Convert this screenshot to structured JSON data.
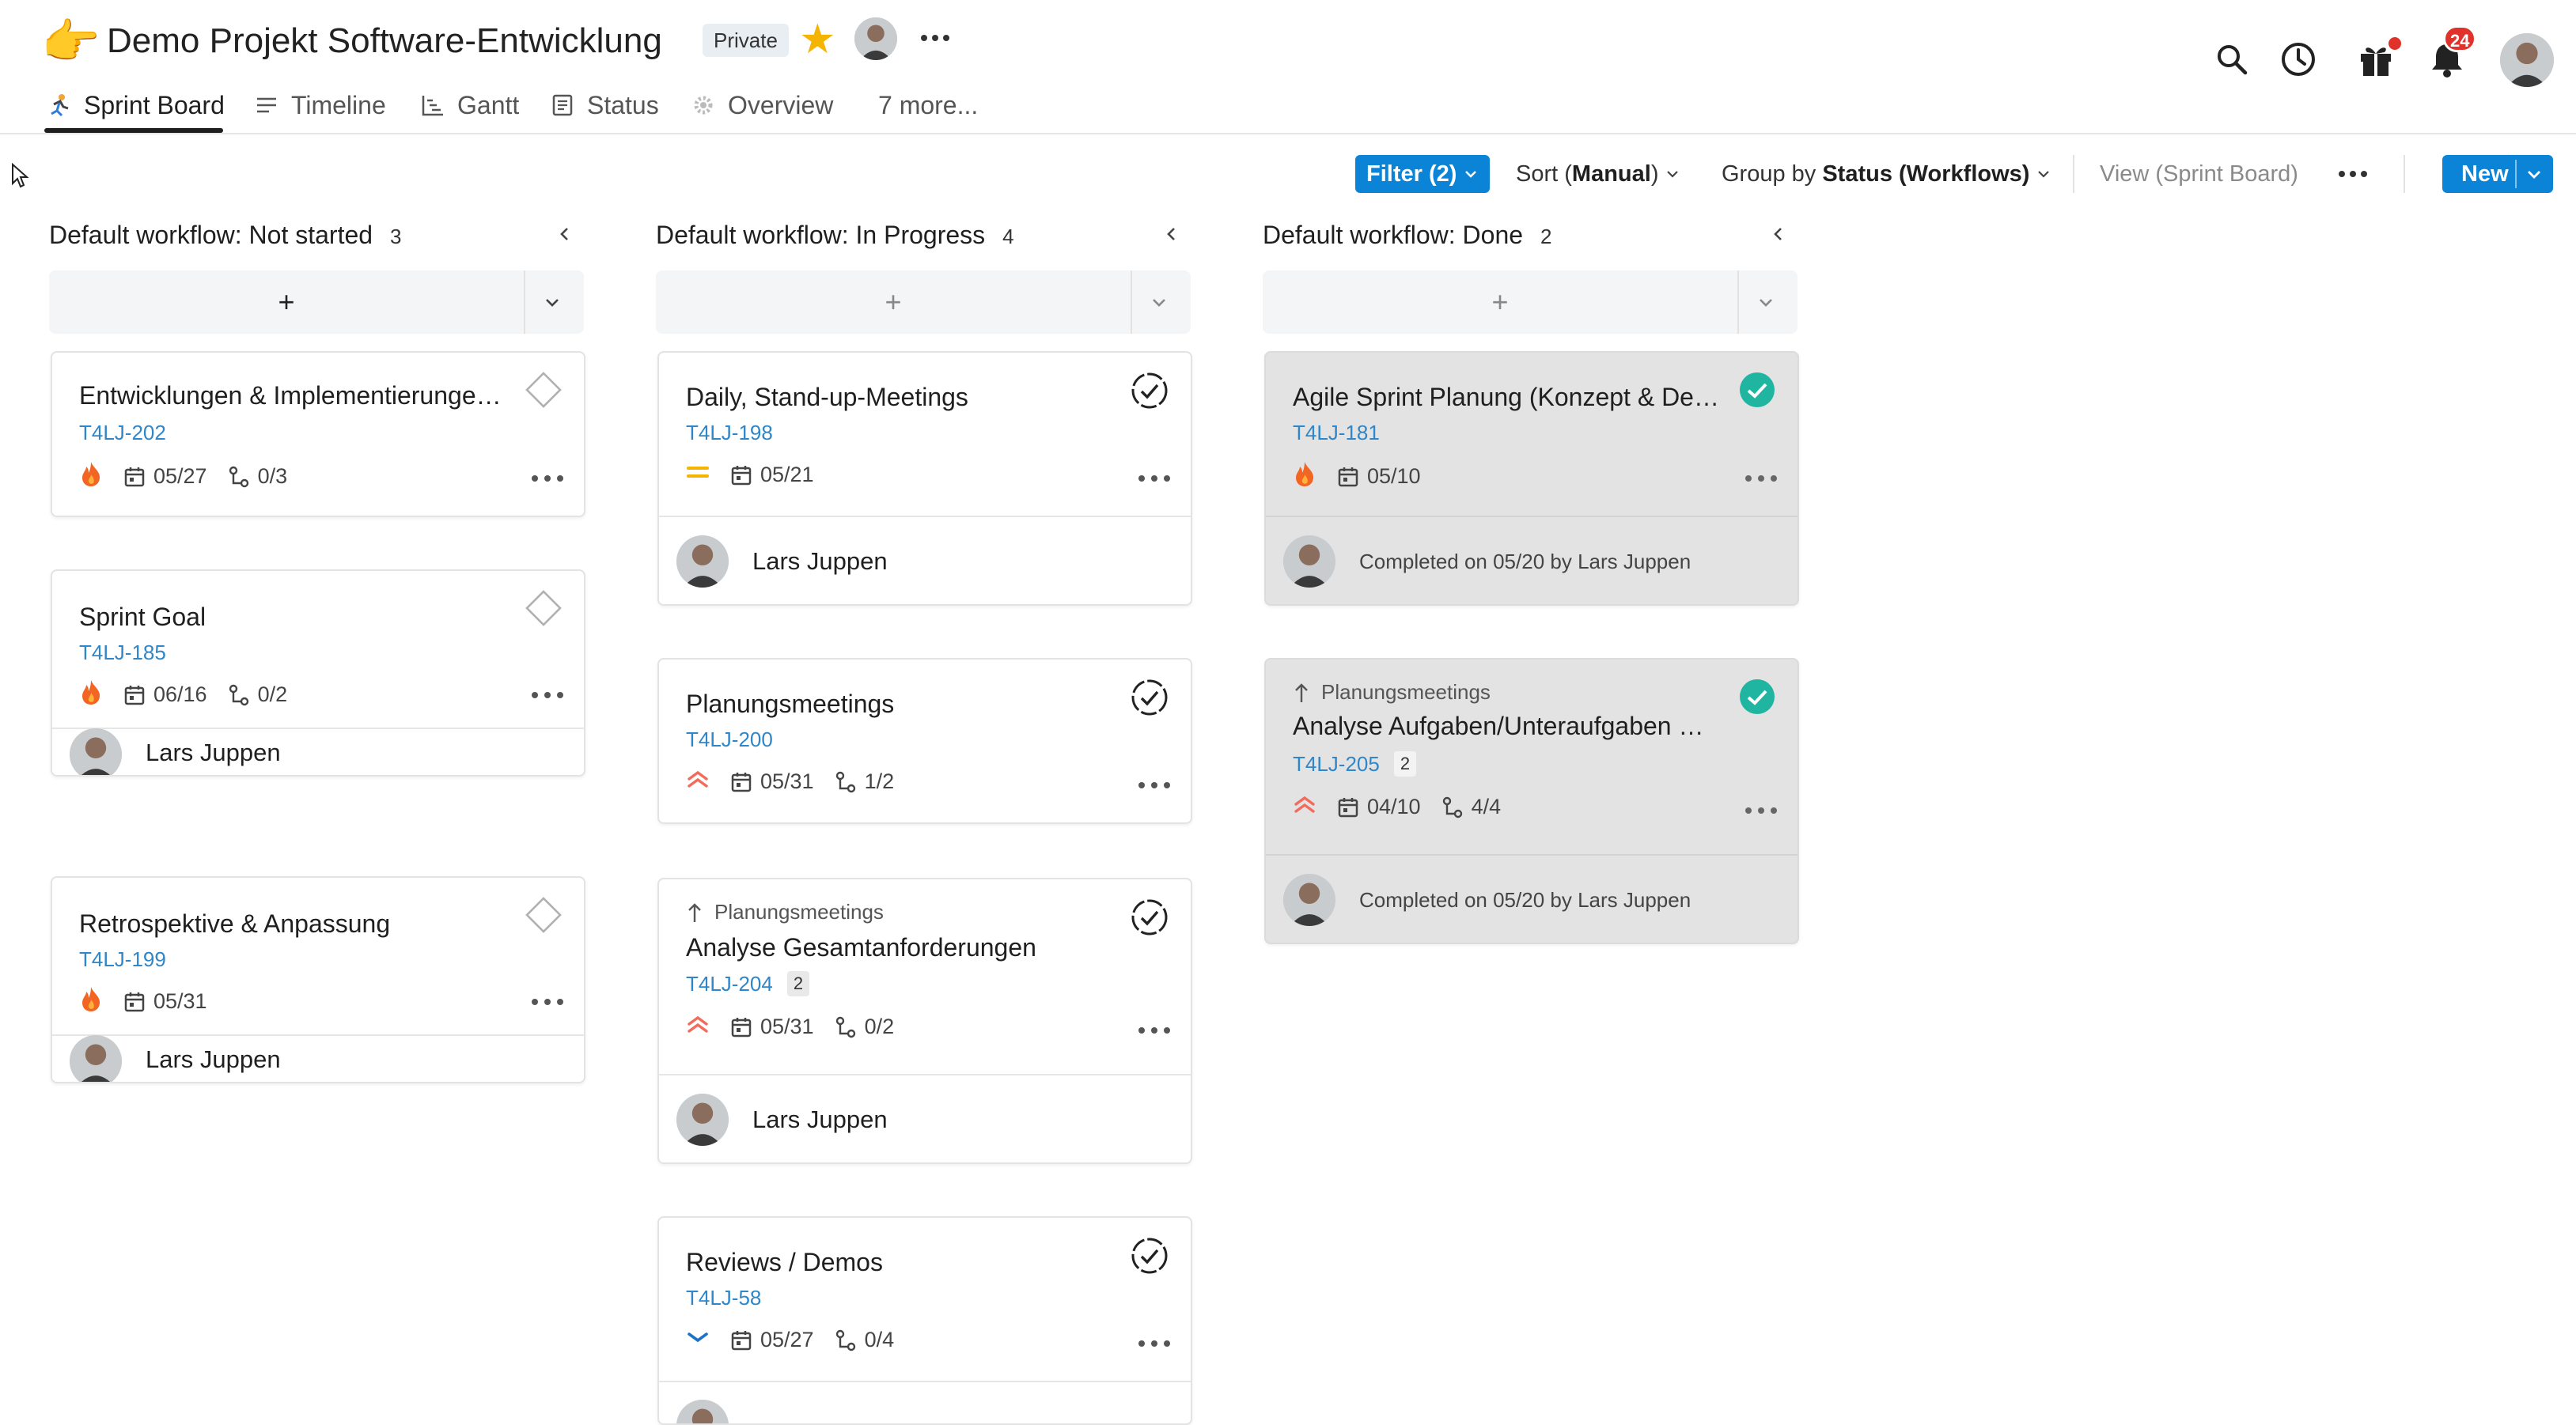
{
  "header": {
    "emoji": "👉",
    "title": "Demo Projekt Software-Entwicklung",
    "privacy_badge": "Private",
    "tabs": [
      {
        "label": "Sprint Board",
        "icon": "sprint-runner-icon",
        "active": true
      },
      {
        "label": "Timeline",
        "icon": "list-lines-icon"
      },
      {
        "label": "Gantt",
        "icon": "gantt-chart-icon"
      },
      {
        "label": "Status",
        "icon": "status-doc-icon"
      },
      {
        "label": "Overview",
        "icon": "overview-gear-icon"
      },
      {
        "label": "7 more..."
      }
    ],
    "notification_count": "24"
  },
  "toolbar": {
    "filter_label": "Filter (2)",
    "sort_prefix": "Sort (",
    "sort_value": "Manual",
    "sort_suffix": ")",
    "group_prefix": "Group by ",
    "group_value": "Status (Workflows)",
    "view_label": "View (Sprint Board)",
    "new_label": "New"
  },
  "columns": [
    {
      "title": "Default workflow: Not started",
      "count": "3",
      "cards": [
        {
          "title": "Entwicklungen & Implementierungen ...",
          "key": "T4LJ-202",
          "priority": "fire",
          "date": "05/27",
          "subtasks": "0/3",
          "assignee": ""
        },
        {
          "title": "Sprint Goal",
          "key": "T4LJ-185",
          "priority": "fire",
          "date": "06/16",
          "subtasks": "0/2",
          "assignee": "Lars Juppen"
        },
        {
          "title": "Retrospektive & Anpassung",
          "key": "T4LJ-199",
          "priority": "fire",
          "date": "05/31",
          "subtasks": "",
          "assignee": "Lars Juppen"
        }
      ]
    },
    {
      "title": "Default workflow: In Progress",
      "count": "4",
      "cards": [
        {
          "title": "Daily, Stand-up-Meetings",
          "key": "T4LJ-198",
          "priority": "medium",
          "date": "05/21",
          "subtasks": "",
          "assignee": "Lars Juppen"
        },
        {
          "title": "Planungsmeetings",
          "key": "T4LJ-200",
          "priority": "high",
          "date": "05/31",
          "subtasks": "1/2",
          "assignee": ""
        },
        {
          "parent": "Planungsmeetings",
          "title": "Analyse Gesamtanforderungen",
          "key": "T4LJ-204",
          "sub_count": "2",
          "priority": "high",
          "date": "05/31",
          "subtasks": "0/2",
          "assignee": "Lars Juppen"
        },
        {
          "title": "Reviews / Demos",
          "key": "T4LJ-58",
          "priority": "low",
          "date": "05/27",
          "subtasks": "0/4",
          "assignee": ""
        }
      ]
    },
    {
      "title": "Default workflow: Done",
      "count": "2",
      "cards": [
        {
          "title": "Agile Sprint Planung (Konzept & Desig...",
          "key": "T4LJ-181",
          "priority": "fire",
          "date": "05/10",
          "subtasks": "",
          "completed": "Completed on 05/20 by Lars Juppen"
        },
        {
          "parent": "Planungsmeetings",
          "title": "Analyse Aufgaben/Unteraufgaben & P...",
          "key": "T4LJ-205",
          "sub_count": "2",
          "priority": "high",
          "date": "04/10",
          "subtasks": "4/4",
          "completed": "Completed on 05/20 by Lars Juppen"
        }
      ]
    }
  ],
  "colors": {
    "accent": "#0b84d8",
    "link": "#2f86c8",
    "done_check": "#1fb5a0",
    "priority_fire": "#f26522",
    "priority_high": "#f26b5b",
    "priority_medium": "#f4b400",
    "priority_low": "#1a73c8",
    "notification": "#e0322a"
  }
}
